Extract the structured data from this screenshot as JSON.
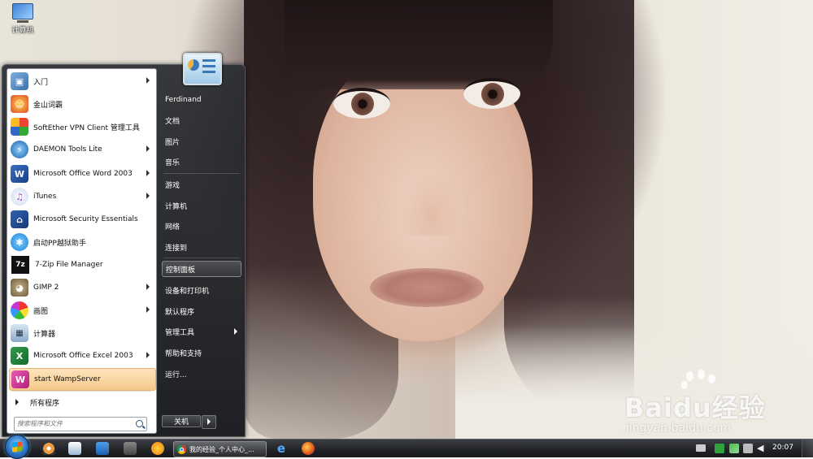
{
  "desktop": {
    "computer_icon_label": "计算机"
  },
  "start_menu": {
    "programs": [
      {
        "label": "入门",
        "icon": "getting-started-icon",
        "has_submenu": true
      },
      {
        "label": "金山词霸",
        "icon": "kingsoft-dict-icon",
        "has_submenu": false
      },
      {
        "label": "SoftEther VPN Client 管理工具",
        "icon": "softether-vpn-icon",
        "has_submenu": false
      },
      {
        "label": "DAEMON Tools Lite",
        "icon": "daemon-tools-icon",
        "has_submenu": true
      },
      {
        "label": "Microsoft Office Word 2003",
        "icon": "word-icon",
        "has_submenu": true
      },
      {
        "label": "iTunes",
        "icon": "itunes-icon",
        "has_submenu": true
      },
      {
        "label": "Microsoft Security Essentials",
        "icon": "security-essentials-icon",
        "has_submenu": false
      },
      {
        "label": "启动PP越狱助手",
        "icon": "pp-jailbreak-icon",
        "has_submenu": false
      },
      {
        "label": "7-Zip File Manager",
        "icon": "7zip-icon",
        "has_submenu": false
      },
      {
        "label": "GIMP 2",
        "icon": "gimp-icon",
        "has_submenu": true
      },
      {
        "label": "画图",
        "icon": "paint-icon",
        "has_submenu": true
      },
      {
        "label": "计算器",
        "icon": "calculator-icon",
        "has_submenu": false
      },
      {
        "label": "Microsoft Office Excel 2003",
        "icon": "excel-icon",
        "has_submenu": true
      },
      {
        "label": "start WampServer",
        "icon": "wampserver-icon",
        "has_submenu": false,
        "highlighted": true
      }
    ],
    "all_programs_label": "所有程序",
    "search_placeholder": "搜索程序和文件",
    "right_items": [
      {
        "label": "Ferdinand"
      },
      {
        "label": "文档"
      },
      {
        "label": "图片"
      },
      {
        "label": "音乐"
      },
      {
        "label": "游戏"
      },
      {
        "label": "计算机"
      },
      {
        "label": "网络"
      },
      {
        "label": "连接到"
      },
      {
        "label": "控制面板",
        "highlighted": true
      },
      {
        "label": "设备和打印机"
      },
      {
        "label": "默认程序"
      },
      {
        "label": "管理工具",
        "has_submenu": true
      },
      {
        "label": "帮助和支持"
      },
      {
        "label": "运行..."
      }
    ],
    "shutdown_label": "关机"
  },
  "taskbar": {
    "active_window_label": "我的经验_个人中心_...",
    "clock": "20:07"
  },
  "watermark": {
    "brand": "Baidu经验",
    "url": "jingyan.baidu.com"
  }
}
